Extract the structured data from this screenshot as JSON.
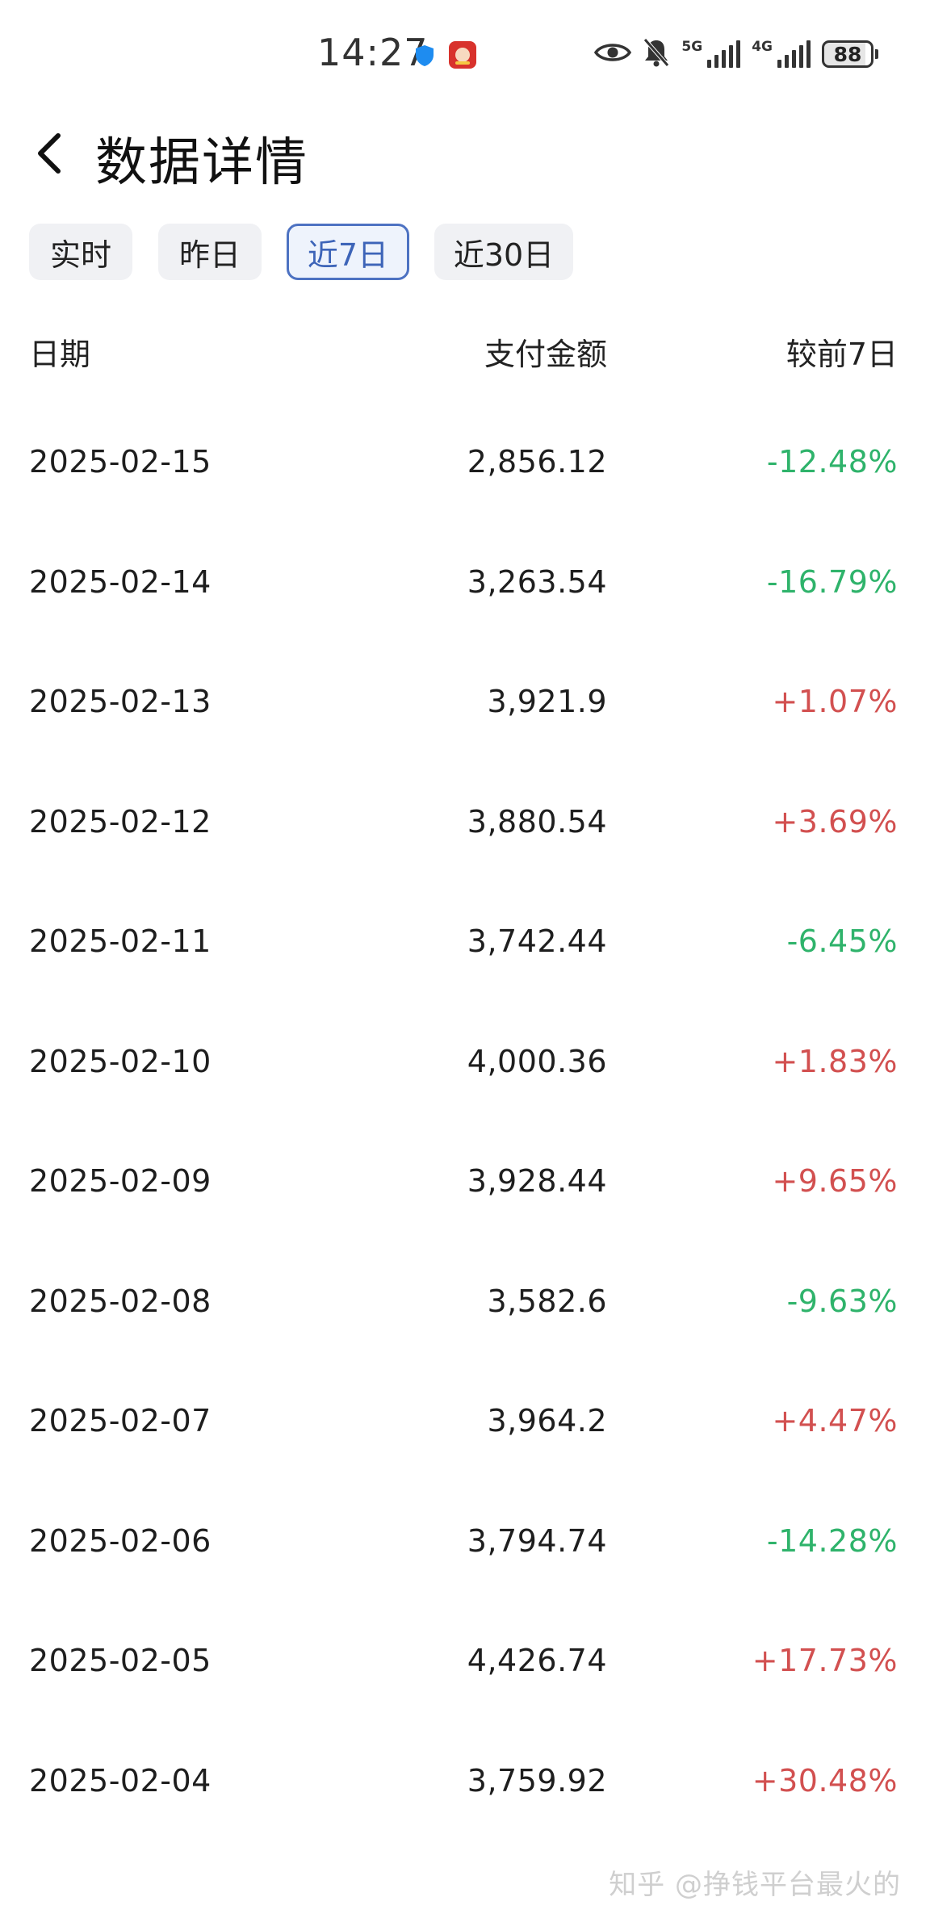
{
  "status_bar": {
    "time": "14:27",
    "signal_1_label": "5G",
    "signal_2_label": "4G",
    "battery": "88",
    "icons": [
      "shield-icon",
      "app-icon",
      "eye-icon",
      "bell-off-icon",
      "signal-icon",
      "battery-icon"
    ]
  },
  "header": {
    "back_icon": "chevron-left-icon",
    "title": "数据详情"
  },
  "tabs": [
    {
      "label": "实时",
      "active": false
    },
    {
      "label": "昨日",
      "active": false
    },
    {
      "label": "近7日",
      "active": true
    },
    {
      "label": "近30日",
      "active": false
    }
  ],
  "table": {
    "headers": {
      "date": "日期",
      "amount": "支付金额",
      "change": "较前7日"
    },
    "rows": [
      {
        "date": "2025-02-15",
        "amount": "2,856.12",
        "change": "-12.48%",
        "trend": "down"
      },
      {
        "date": "2025-02-14",
        "amount": "3,263.54",
        "change": "-16.79%",
        "trend": "down"
      },
      {
        "date": "2025-02-13",
        "amount": "3,921.9",
        "change": "+1.07%",
        "trend": "up"
      },
      {
        "date": "2025-02-12",
        "amount": "3,880.54",
        "change": "+3.69%",
        "trend": "up"
      },
      {
        "date": "2025-02-11",
        "amount": "3,742.44",
        "change": "-6.45%",
        "trend": "down"
      },
      {
        "date": "2025-02-10",
        "amount": "4,000.36",
        "change": "+1.83%",
        "trend": "up"
      },
      {
        "date": "2025-02-09",
        "amount": "3,928.44",
        "change": "+9.65%",
        "trend": "up"
      },
      {
        "date": "2025-02-08",
        "amount": "3,582.6",
        "change": "-9.63%",
        "trend": "down"
      },
      {
        "date": "2025-02-07",
        "amount": "3,964.2",
        "change": "+4.47%",
        "trend": "up"
      },
      {
        "date": "2025-02-06",
        "amount": "3,794.74",
        "change": "-14.28%",
        "trend": "down"
      },
      {
        "date": "2025-02-05",
        "amount": "4,426.74",
        "change": "+17.73%",
        "trend": "up"
      },
      {
        "date": "2025-02-04",
        "amount": "3,759.92",
        "change": "+30.48%",
        "trend": "up"
      }
    ]
  },
  "colors": {
    "up": "#d25050",
    "down": "#2fb36b",
    "accent": "#4d72c2"
  },
  "watermark": "知乎 @挣钱平台最火的"
}
